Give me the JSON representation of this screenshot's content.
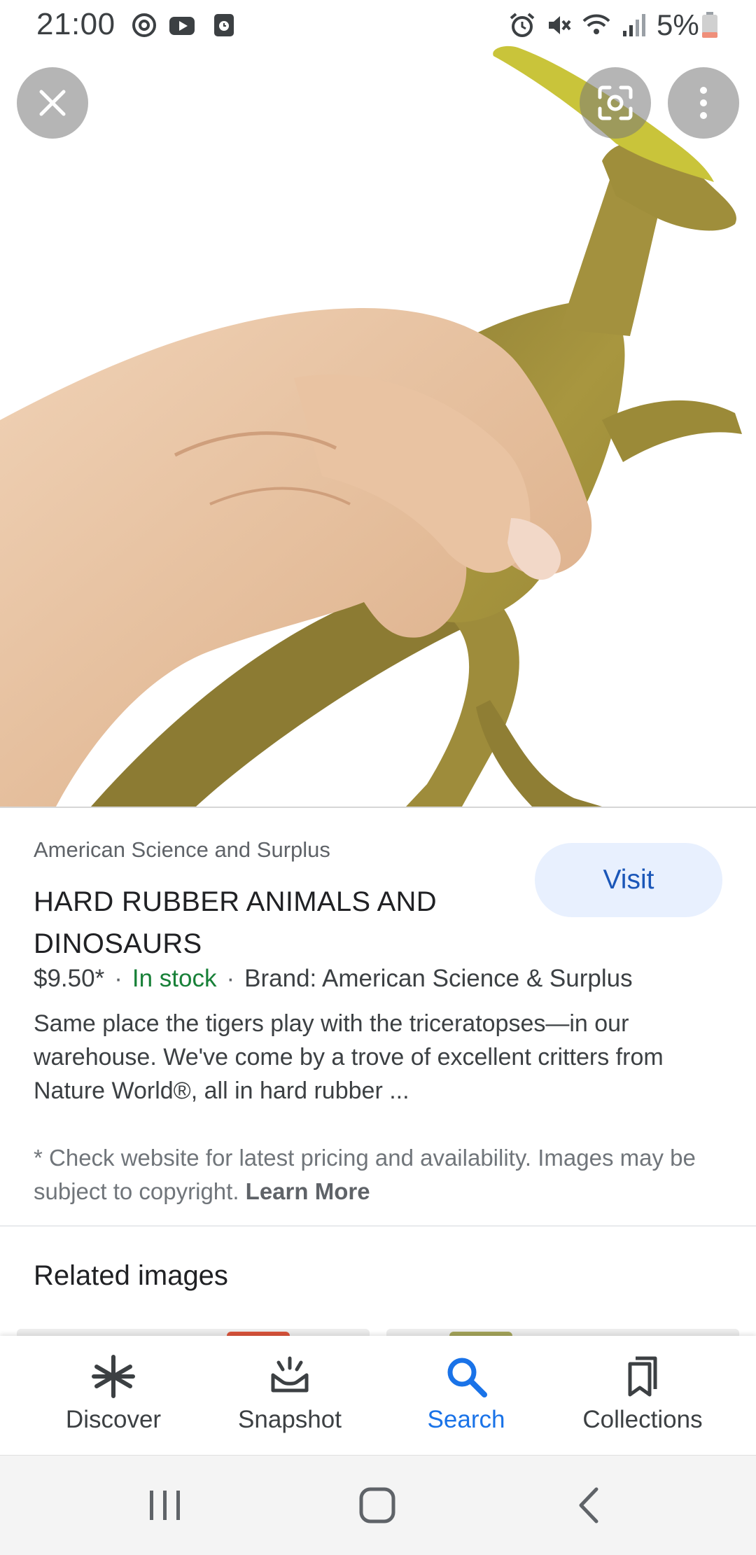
{
  "status_bar": {
    "time": "21:00",
    "battery": "5%",
    "left_icons": [
      "sync-icon",
      "youtube-icon",
      "clock-app-icon"
    ],
    "right_icons": [
      "alarm-icon",
      "mute-icon",
      "wifi-icon",
      "signal-icon",
      "battery-low-icon"
    ]
  },
  "hero": {
    "close_icon": "close-icon",
    "lens_icon": "google-lens-icon",
    "menu_icon": "more-vert-icon"
  },
  "result": {
    "source": "American Science and Surplus",
    "title": "HARD RUBBER ANIMALS AND DINOSAURS",
    "visit_label": "Visit",
    "price": "$9.50*",
    "stock": "In stock",
    "brand": "Brand: American Science & Surplus",
    "description": "Same place the tigers play with the triceratopses—in our warehouse. We've come by a trove of excellent critters from Nature World®, all in hard rubber ...",
    "disclaimer": "* Check website for latest pricing and availability. Images may be subject to copyright.",
    "learn_more": "Learn More"
  },
  "related": {
    "title": "Related images"
  },
  "bottom_nav": {
    "items": [
      {
        "label": "Discover",
        "icon": "asterisk-icon",
        "active": false
      },
      {
        "label": "Snapshot",
        "icon": "snapshot-icon",
        "active": false
      },
      {
        "label": "Search",
        "icon": "search-icon",
        "active": true
      },
      {
        "label": "Collections",
        "icon": "bookmarks-icon",
        "active": false
      }
    ]
  },
  "colors": {
    "accent": "#1a73e8",
    "in_stock": "#188038",
    "visit_bg": "#e8f0fe",
    "visit_text": "#1a56b8",
    "dino_body": "#a89440",
    "dino_crest": "#c9c43a",
    "skin": "#e8c4a4"
  }
}
